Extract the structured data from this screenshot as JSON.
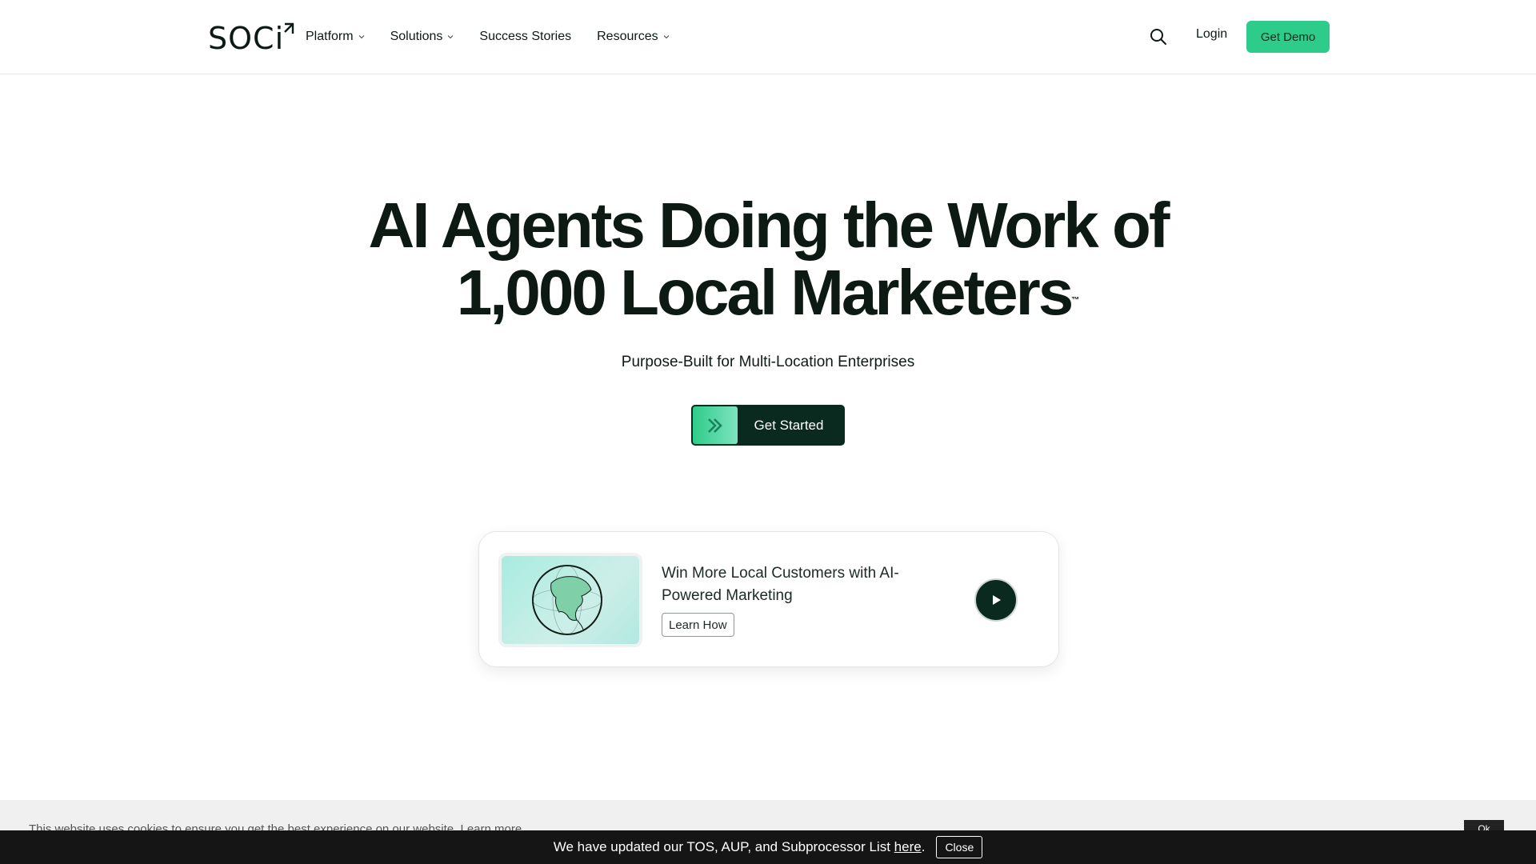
{
  "header": {
    "logo_text": "SOCi",
    "nav": [
      {
        "label": "Platform",
        "has_dropdown": true
      },
      {
        "label": "Solutions",
        "has_dropdown": true
      },
      {
        "label": "Success Stories",
        "has_dropdown": false
      },
      {
        "label": "Resources",
        "has_dropdown": true
      }
    ],
    "search_icon": "search-icon",
    "login_label": "Login",
    "demo_label": "Get Demo"
  },
  "hero": {
    "title_line1": "AI Agents Doing the Work of",
    "title_line2": "1,000 Local Marketers",
    "trademark": "™",
    "subtitle": "Purpose-Built for Multi-Location Enterprises",
    "cta_label": "Get Started",
    "cta_icon": "double-chevron-right-icon"
  },
  "promo_card": {
    "thumbnail_icon": "globe-icon",
    "title": "Win More Local Customers with AI-Powered Marketing",
    "learn_label": "Learn How",
    "play_icon": "play-icon"
  },
  "cookie_bar": {
    "text": "This website uses cookies to ensure you get the best experience on our website.",
    "learn_more": "Learn more",
    "ok_label": "Ok"
  },
  "tos_bar": {
    "text": "We have updated our TOS, AUP, and Subprocessor List",
    "link": "here",
    "period": ".",
    "close_label": "Close"
  },
  "colors": {
    "accent_green": "#2ecc8b",
    "dark_green": "#0a2a1f",
    "text": "#0d1a14",
    "tos_bg": "#151515"
  }
}
